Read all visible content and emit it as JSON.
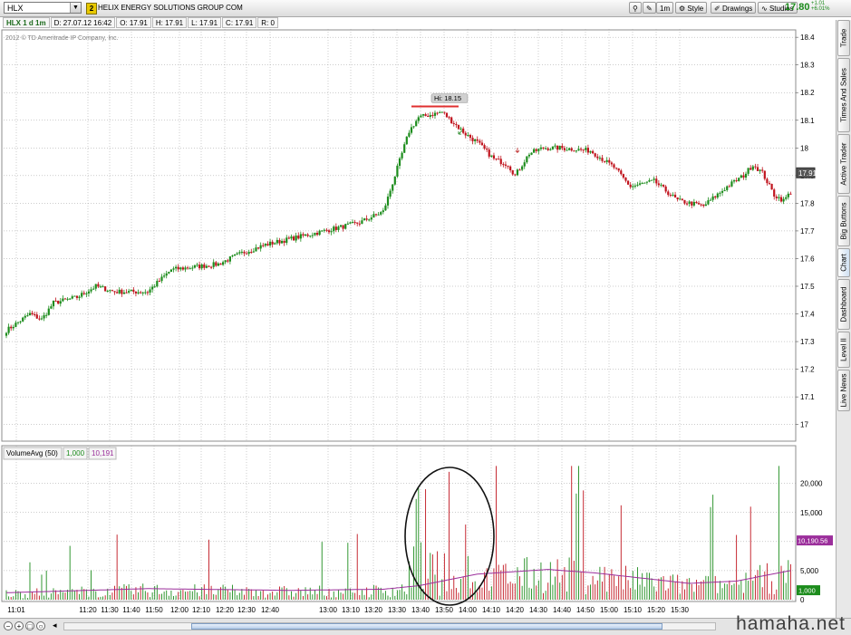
{
  "toolbar": {
    "symbol": "HLX",
    "link_badge": "2",
    "company": "HELIX ENERGY SOLUTIONS GROUP COM",
    "interval": "1m",
    "style_label": "Style",
    "drawings_label": "Drawings",
    "studies_label": "Studies",
    "last_price": "17.80",
    "net_change": "+1.01",
    "pct_change": "+6.01%"
  },
  "infobar": {
    "period": "HLX 1 d 1m",
    "date": "D: 27.07.12 16:42",
    "open": "O: 17.91",
    "high": "H: 17.91",
    "low": "L: 17.91",
    "close": "C: 17.91",
    "range": "R: 0"
  },
  "copyright": "2012 © TD Ameritrade IP Company, Inc.",
  "price_axis": {
    "labels": [
      "18.4",
      "18.3",
      "18.2",
      "18.1",
      "18",
      "17.9",
      "17.8",
      "17.7",
      "17.6",
      "17.5",
      "17.4",
      "17.3",
      "17.2",
      "17.1",
      "17"
    ],
    "last_marker": "17.91"
  },
  "high_label": "Hi: 18.15",
  "volume_study": {
    "name": "VolumeAvg (50)",
    "value1": "1,000",
    "value2": "10,191",
    "axis_labels": [
      "20,000",
      "15,000",
      "10,000",
      "5,000",
      "0"
    ],
    "marker_avg": "10,190.56",
    "marker_vol": "1,000"
  },
  "time_axis": [
    "11:01",
    "11:20",
    "11:30",
    "11:40",
    "11:50",
    "12:00",
    "12:10",
    "12:20",
    "12:30",
    "12:40",
    "13:00",
    "13:10",
    "13:20",
    "13:30",
    "13:40",
    "13:50",
    "14:00",
    "14:10",
    "14:20",
    "14:30",
    "14:40",
    "14:50",
    "15:00",
    "15:10",
    "15:20",
    "15:30"
  ],
  "side_tabs": [
    "Trade",
    "Times And Sales",
    "Active Trader",
    "Big Buttons",
    "Chart",
    "Dashboard",
    "Level II",
    "Live News"
  ],
  "watermark": "hamaha.net",
  "colors": {
    "up": "#1c8c1c",
    "down": "#c0141e",
    "grid": "#9a9a9a",
    "avg": "#9b2e9b",
    "hi_line": "#e03030"
  },
  "chart_data": {
    "type": "candlestick",
    "ylim": [
      16.94,
      18.43
    ],
    "close_anchors": [
      [
        0,
        17.34
      ],
      [
        10,
        17.4
      ],
      [
        15,
        17.38
      ],
      [
        20,
        17.44
      ],
      [
        30,
        17.46
      ],
      [
        38,
        17.5
      ],
      [
        46,
        17.48
      ],
      [
        60,
        17.48
      ],
      [
        65,
        17.52
      ],
      [
        70,
        17.56
      ],
      [
        80,
        17.57
      ],
      [
        90,
        17.58
      ],
      [
        100,
        17.62
      ],
      [
        110,
        17.65
      ],
      [
        120,
        17.67
      ],
      [
        135,
        17.7
      ],
      [
        150,
        17.73
      ],
      [
        160,
        17.77
      ],
      [
        162,
        17.82
      ],
      [
        165,
        17.9
      ],
      [
        168,
        17.98
      ],
      [
        171,
        18.06
      ],
      [
        175,
        18.11
      ],
      [
        180,
        18.12
      ],
      [
        185,
        18.13
      ],
      [
        190,
        18.09
      ],
      [
        195,
        18.05
      ],
      [
        200,
        18.02
      ],
      [
        207,
        17.96
      ],
      [
        213,
        17.94
      ],
      [
        216,
        17.9
      ],
      [
        222,
        17.98
      ],
      [
        228,
        18.0
      ],
      [
        235,
        18.0
      ],
      [
        248,
        17.99
      ],
      [
        258,
        17.93
      ],
      [
        265,
        17.86
      ],
      [
        275,
        17.88
      ],
      [
        285,
        17.81
      ],
      [
        296,
        17.79
      ],
      [
        306,
        17.86
      ],
      [
        313,
        17.9
      ],
      [
        317,
        17.94
      ],
      [
        321,
        17.91
      ],
      [
        326,
        17.83
      ],
      [
        330,
        17.81
      ],
      [
        333,
        17.84
      ]
    ],
    "high": 18.15,
    "volume_ylim": [
      0,
      24000
    ],
    "volume_average_anchors": [
      [
        0,
        1200
      ],
      [
        60,
        1900
      ],
      [
        120,
        1600
      ],
      [
        160,
        1800
      ],
      [
        175,
        2400
      ],
      [
        200,
        4400
      ],
      [
        230,
        5200
      ],
      [
        250,
        4600
      ],
      [
        290,
        2800
      ],
      [
        310,
        3200
      ],
      [
        333,
        5000
      ]
    ]
  }
}
